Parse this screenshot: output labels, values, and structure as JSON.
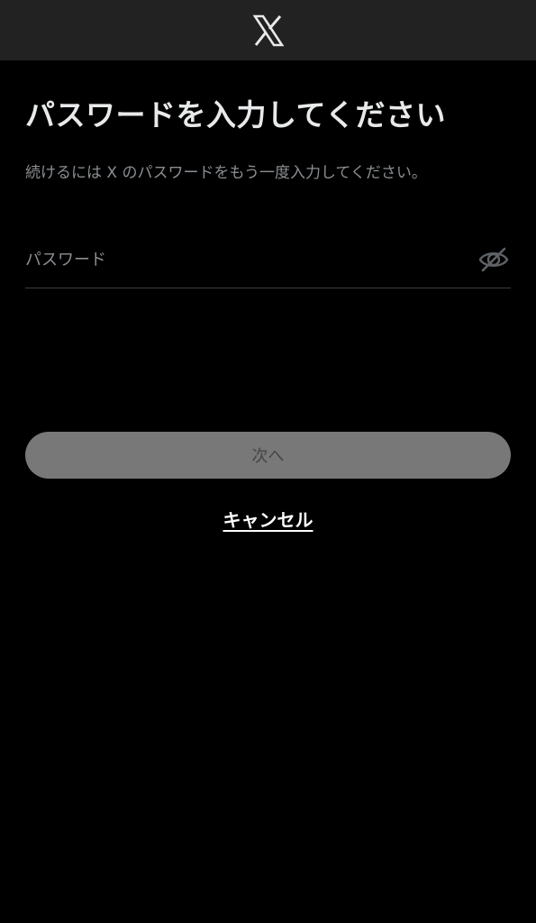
{
  "header": {
    "logo_icon": "x-logo-icon",
    "background": "#222222"
  },
  "main": {
    "title": "パスワードを入力してください",
    "subtitle": "続けるには X のパスワードをもう一度入力してください。",
    "password_field": {
      "placeholder": "パスワード",
      "value": "",
      "toggle_icon": "eye-slash-icon"
    },
    "next_button": {
      "label": "次へ",
      "background": "#787878"
    },
    "cancel_link": {
      "label": "キャンセル"
    }
  }
}
